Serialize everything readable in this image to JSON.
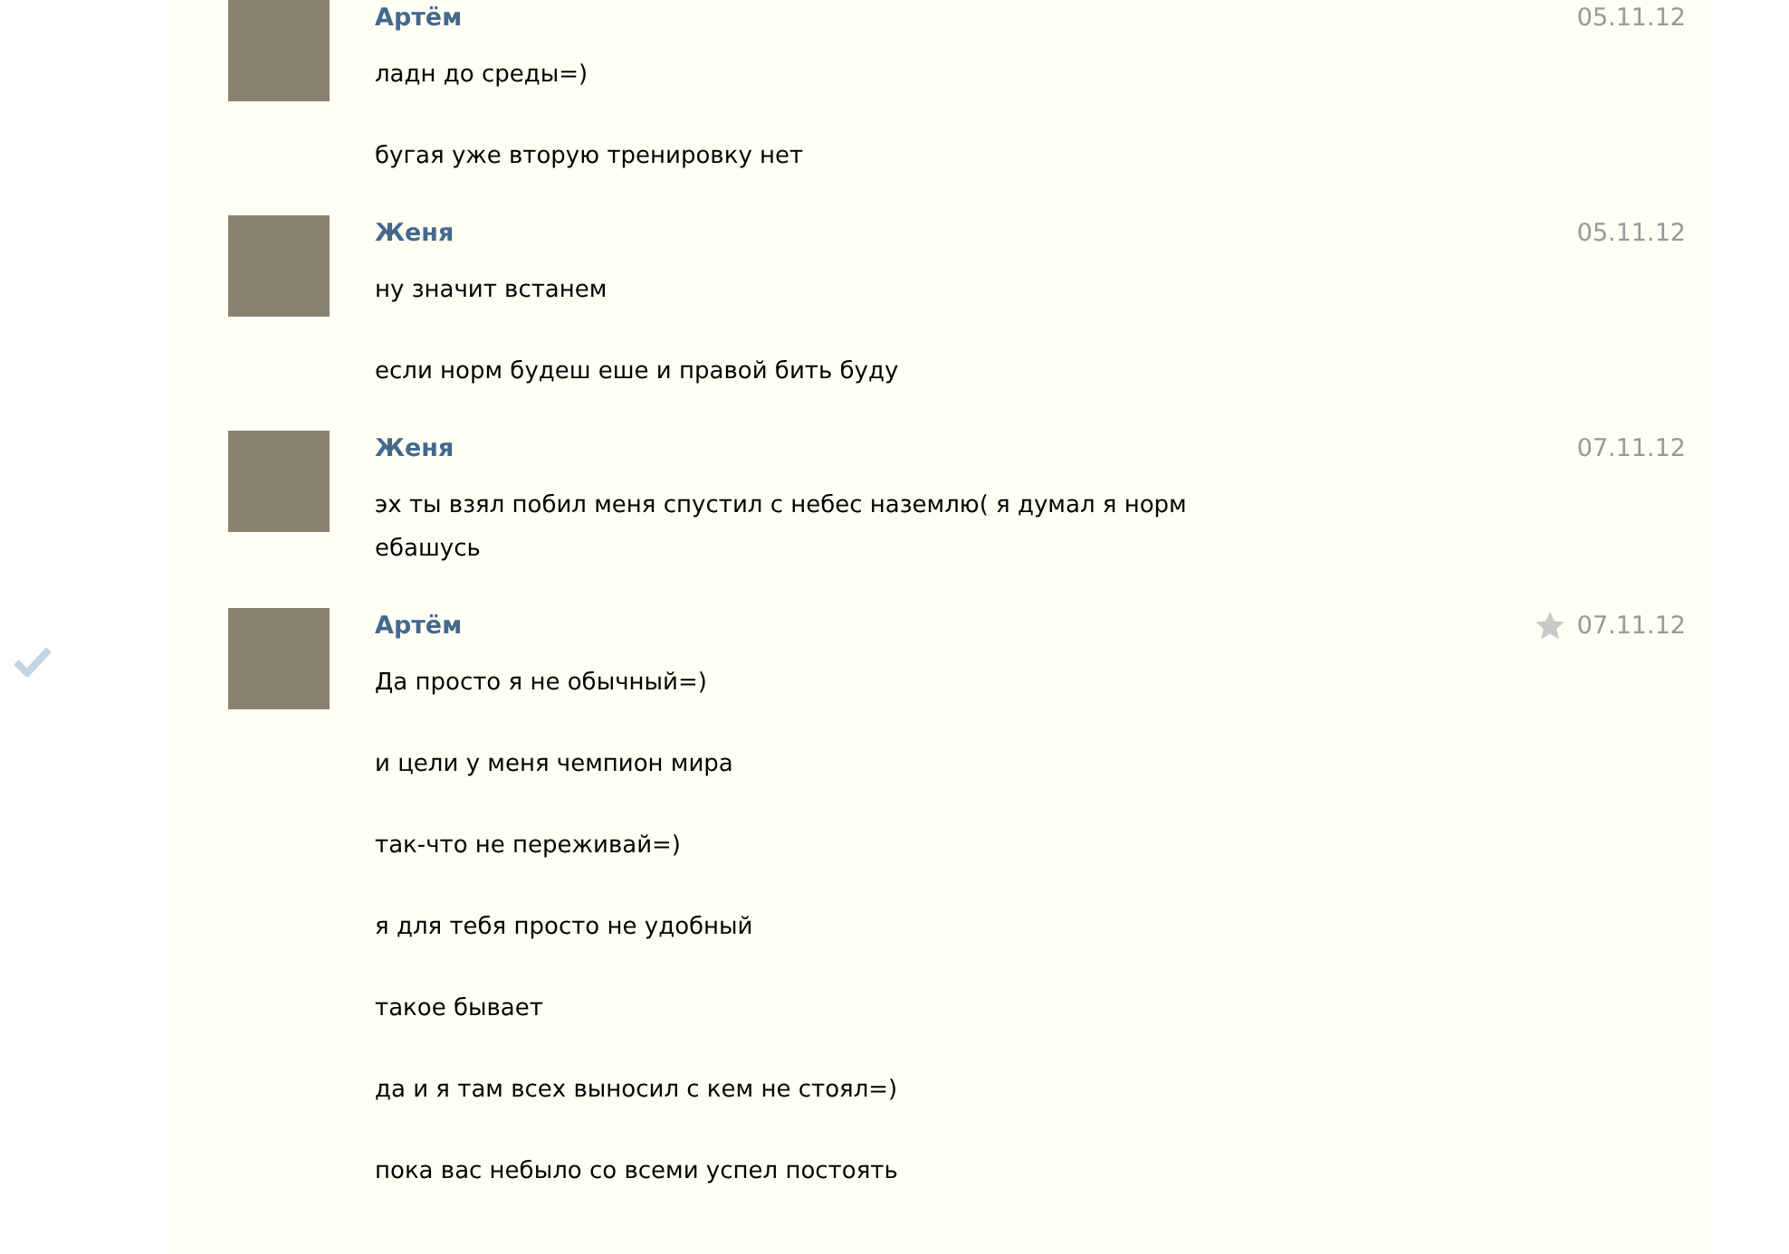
{
  "messages": [
    {
      "author": "Артём",
      "date": "05.11.12",
      "starred": false,
      "checked": false,
      "lines": [
        "ладн до среды=)",
        "бугая уже вторую тренировку нет"
      ]
    },
    {
      "author": "Женя",
      "date": "05.11.12",
      "starred": false,
      "checked": false,
      "lines": [
        "ну значит встанем",
        "если норм будеш еше и правой бить буду"
      ]
    },
    {
      "author": "Женя",
      "date": "07.11.12",
      "starred": false,
      "checked": false,
      "lines": [
        "эх ты взял побил меня спустил с небес наземлю( я думал я норм ебашусь"
      ]
    },
    {
      "author": "Артём",
      "date": "07.11.12",
      "starred": true,
      "checked": true,
      "lines": [
        "Да просто я не обычный=)",
        "и цели у меня чемпион мира",
        "так-что не переживай=)",
        "я для тебя просто не удобный",
        "такое бывает",
        "да и я там всех выносил с кем не стоял=)",
        "пока вас небыло со всеми успел постоять"
      ]
    }
  ]
}
